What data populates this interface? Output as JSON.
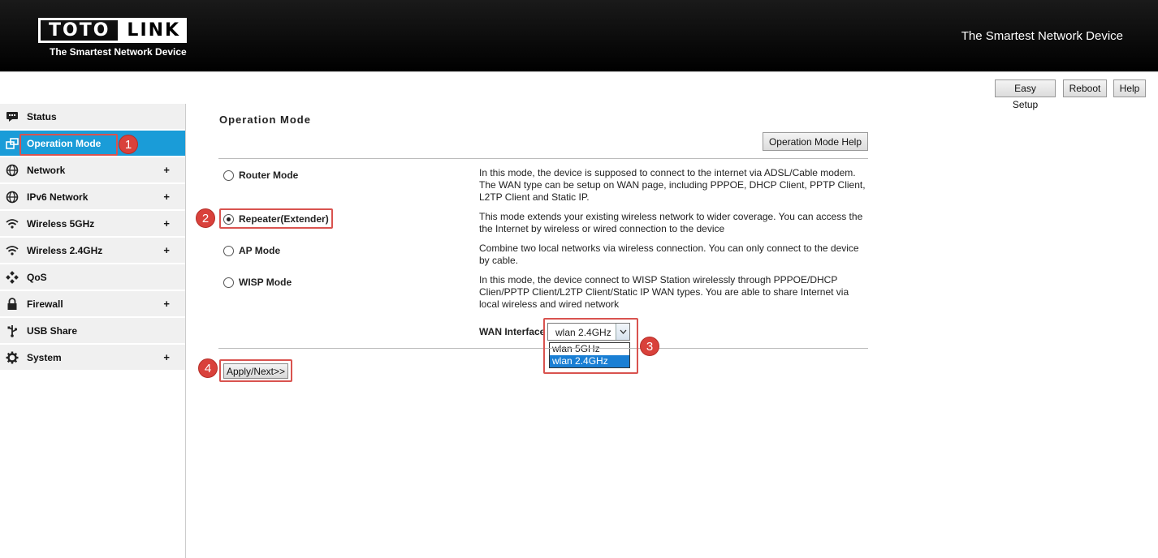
{
  "header": {
    "logo_left": "TOTO",
    "logo_right": "LINK",
    "logo_tagline": "The Smartest Network Device",
    "slogan": "The Smartest Network Device"
  },
  "toolbar": {
    "easy_setup": "Easy Setup",
    "reboot": "Reboot",
    "help": "Help"
  },
  "sidebar": {
    "items": [
      {
        "label": "Status",
        "icon": "status-icon",
        "expandable": false
      },
      {
        "label": "Operation Mode",
        "icon": "operation-mode-icon",
        "expandable": false,
        "active": true
      },
      {
        "label": "Network",
        "icon": "globe-icon",
        "expandable": true
      },
      {
        "label": "IPv6 Network",
        "icon": "globe-icon",
        "expandable": true
      },
      {
        "label": "Wireless 5GHz",
        "icon": "wifi-icon",
        "expandable": true
      },
      {
        "label": "Wireless 2.4GHz",
        "icon": "wifi-icon",
        "expandable": true
      },
      {
        "label": "QoS",
        "icon": "qos-icon",
        "expandable": false
      },
      {
        "label": "Firewall",
        "icon": "lock-icon",
        "expandable": true
      },
      {
        "label": "USB Share",
        "icon": "usb-icon",
        "expandable": false
      },
      {
        "label": "System",
        "icon": "gear-icon",
        "expandable": true
      }
    ],
    "plus": "+"
  },
  "main": {
    "title": "Operation Mode",
    "help_button": "Operation Mode Help",
    "modes": [
      {
        "label": "Router Mode",
        "checked": false,
        "desc": "In this mode, the device is supposed to connect to the internet via ADSL/Cable modem. The WAN type can be setup on WAN page, including PPPOE, DHCP Client, PPTP Client, L2TP Client and Static IP."
      },
      {
        "label": "Repeater(Extender)",
        "checked": true,
        "desc": "This mode extends your existing wireless network to wider coverage. You can access the the Internet by wireless or wired connection to the device"
      },
      {
        "label": "AP Mode",
        "checked": false,
        "desc": "Combine two local networks via wireless connection. You can only connect to the device by cable."
      },
      {
        "label": "WISP Mode",
        "checked": false,
        "desc": "In this mode, the device connect to WISP Station wirelessly through PPPOE/DHCP Clien/PPTP Client/L2TP Client/Static IP WAN types. You are able to share Internet via local wireless and wired network"
      }
    ],
    "wan_interface_label": "WAN Interface",
    "wan_interface_value": "wlan 2.4GHz",
    "wan_options": [
      "wlan 5GHz",
      "wlan 2.4GHz"
    ],
    "apply_button": "Apply/Next>>"
  },
  "annotations": {
    "badge1": "1",
    "badge2": "2",
    "badge3": "3",
    "badge4": "4",
    "highlight_color": "#d9534f"
  },
  "colors": {
    "accent": "#1a9cd8",
    "header_bg": "#000000"
  }
}
